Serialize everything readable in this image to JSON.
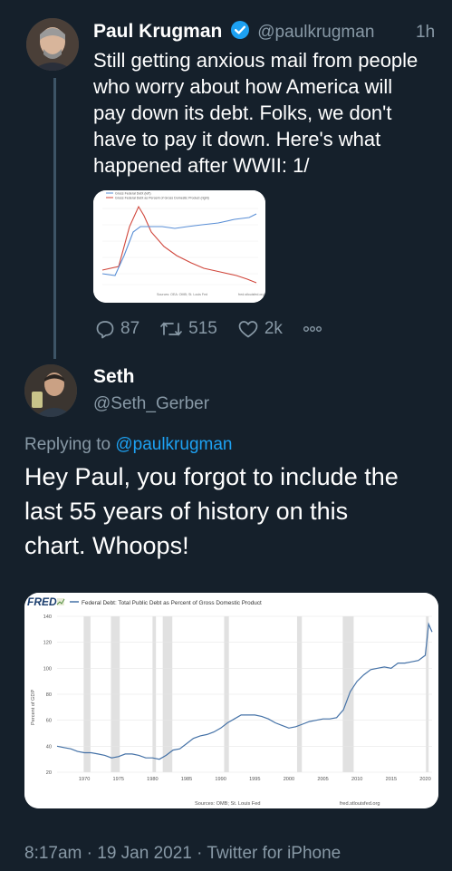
{
  "tweet1": {
    "author_name": "Paul Krugman",
    "author_handle": "@paulkrugman",
    "time": "1h",
    "text_lines": [
      "Still getting anxious mail from people",
      "who worry about how America will",
      "pay down its debt. Folks, we don't",
      "have to pay it down. Here's what",
      "happened after WWII: 1/"
    ],
    "actions": {
      "replies": "87",
      "retweets": "515",
      "likes": "2k"
    },
    "chart_thumb": {
      "legend": [
        "Gross Federal Debt (left)",
        "Gross Federal Debt as Percent of Gross Domestic Product (right)"
      ],
      "source": "Sources: OEA: OMB; St. Louis Fed",
      "footer_right": "fred.stlouisfed.org",
      "colors": {
        "debt": "#5a8fd6",
        "percent": "#d0463b"
      }
    }
  },
  "tweet2": {
    "author_name": "Seth",
    "author_handle": "@Seth_Gerber",
    "replying_prefix": "Replying to",
    "replying_to": "@paulkrugman",
    "text_lines": [
      "Hey Paul, you forgot to include the",
      "last 55 years of history on this",
      "chart. Whoops!"
    ],
    "timestamp": "8:17am · 19 Jan 2021 · Twitter for iPhone"
  },
  "chart_data": {
    "type": "line",
    "brand": "FRED",
    "title": "Federal Debt: Total Public Debt as Percent of Gross Domestic Product",
    "ylabel": "Percent of GDP",
    "xlabel": "",
    "ylim": [
      20,
      140
    ],
    "yticks": [
      20,
      40,
      60,
      80,
      100,
      120,
      140
    ],
    "xlim": [
      1966,
      2021
    ],
    "xticks": [
      1970,
      1975,
      1980,
      1985,
      1990,
      1995,
      2000,
      2005,
      2010,
      2015,
      2020
    ],
    "recessions": [
      [
        1969.9,
        1970.9
      ],
      [
        1973.9,
        1975.2
      ],
      [
        1980.0,
        1980.5
      ],
      [
        1981.5,
        1982.9
      ],
      [
        1990.5,
        1991.2
      ],
      [
        2001.2,
        2001.9
      ],
      [
        2007.9,
        2009.5
      ],
      [
        2020.1,
        2020.5
      ]
    ],
    "source": "Sources: OMB; St. Louis Fed",
    "footer_right": "fred.stlouisfed.org",
    "grid": true,
    "colors": {
      "line": "#4572a7",
      "recession": "#e1e1e1"
    },
    "series": [
      {
        "x": [
          1966,
          1967,
          1968,
          1969,
          1970,
          1971,
          1972,
          1973,
          1974,
          1975,
          1976,
          1977,
          1978,
          1979,
          1980,
          1981,
          1982,
          1983,
          1984,
          1985,
          1986,
          1987,
          1988,
          1989,
          1990,
          1991,
          1992,
          1993,
          1994,
          1995,
          1996,
          1997,
          1998,
          1999,
          2000,
          2001,
          2002,
          2003,
          2004,
          2005,
          2006,
          2007,
          2008,
          2009,
          2010,
          2011,
          2012,
          2013,
          2014,
          2015,
          2016,
          2017,
          2018,
          2019,
          2020,
          2020.5,
          2021
        ],
        "values": [
          40,
          39,
          38,
          36,
          35,
          35,
          34,
          33,
          31,
          32,
          34,
          34,
          33,
          31,
          31,
          30,
          33,
          37,
          38,
          42,
          46,
          48,
          49,
          51,
          54,
          58,
          61,
          64,
          64,
          64,
          63,
          61,
          58,
          56,
          54,
          55,
          57,
          59,
          60,
          61,
          61,
          62,
          68,
          82,
          90,
          95,
          99,
          100,
          101,
          100,
          104,
          104,
          105,
          106,
          110,
          134,
          128
        ]
      }
    ]
  }
}
